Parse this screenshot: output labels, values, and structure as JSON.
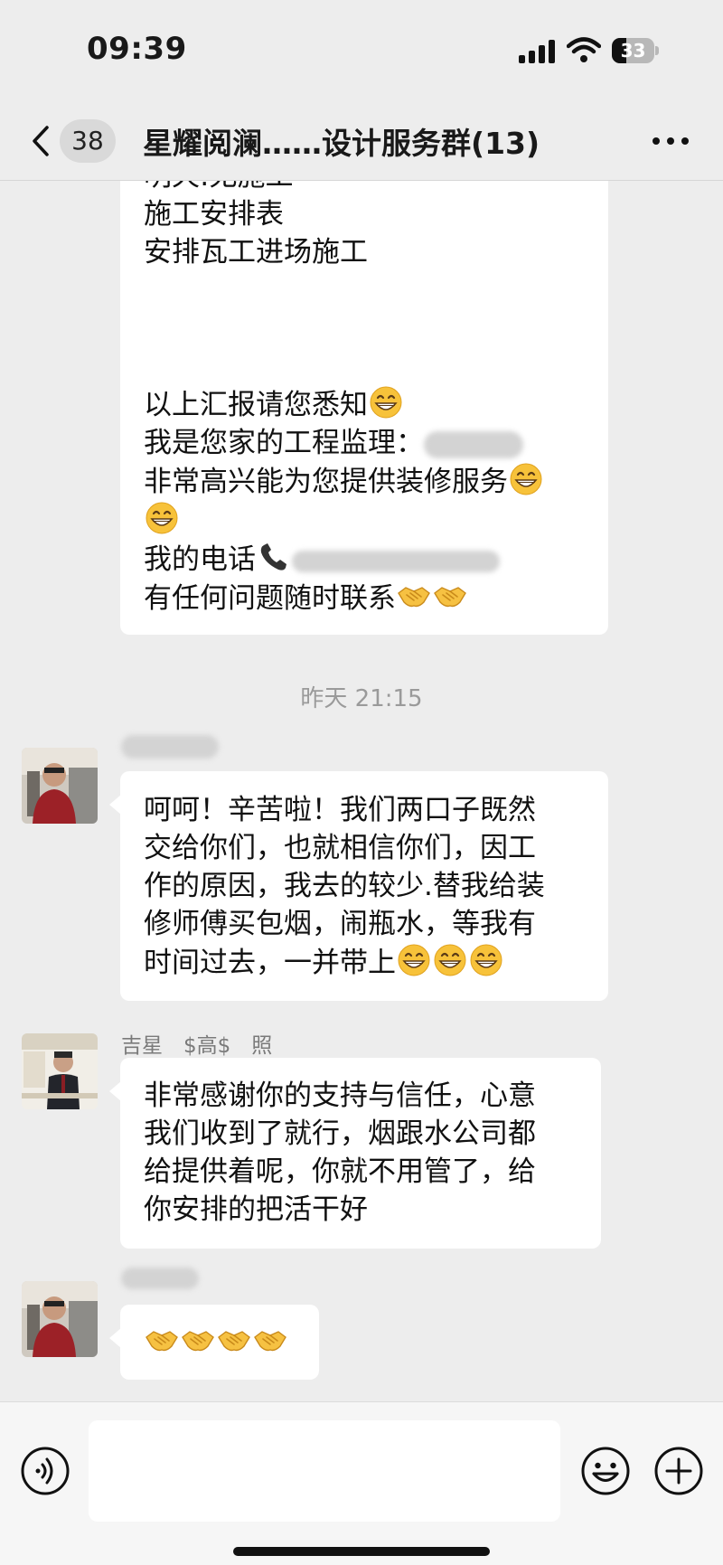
{
  "status_bar": {
    "time": "09:39",
    "battery": "33",
    "battery_level": 0.33
  },
  "nav": {
    "unread_count": "38",
    "title": "星耀阅澜……设计服务群(13)"
  },
  "chat": {
    "message_1_lines": [
      "明天:无施工",
      "施工安排表",
      "安排瓦工进场施工",
      "",
      "",
      "",
      "以上汇报请您悉知",
      "我是您家的工程监理：",
      "非常高兴能为您提供装修服务",
      "",
      "我的电话",
      "有任何问题随时联系"
    ],
    "timestamp": "昨天 21:15",
    "message_2_lines": [
      "呵呵！辛苦啦！我们两口子既然",
      "交给你们，也就相信你们，因工",
      "作的原因，我去的较少.替我给装",
      "修师傅买包烟，闹瓶水，等我有",
      "时间过去，一并带上"
    ],
    "message_3_sender": "吉星　$高$　照",
    "message_3_lines": [
      "非常感谢你的支持与信任，心意",
      "我们收到了就行，烟跟水公司都",
      "给提供着呢，你就不用管了，给",
      "你安排的把活干好"
    ]
  },
  "icons": {
    "back": "chevron-left-icon",
    "more": "ellipsis-icon",
    "voice": "voice-icon",
    "emoji": "smiley-icon",
    "plus": "plus-icon",
    "grin": "grinning-emoji",
    "handshake": "handshake-emoji",
    "phone": "telephone-emoji"
  },
  "colors": {
    "background": "#ededed",
    "bubble": "#ffffff",
    "emoji": "#f7c23a"
  }
}
